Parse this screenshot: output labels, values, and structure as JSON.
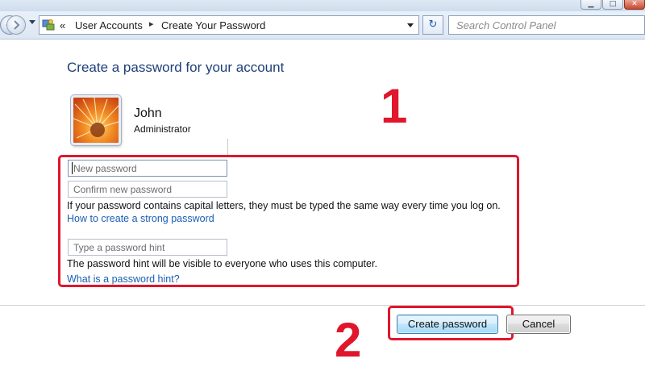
{
  "window": {
    "minimize_glyph": "▁",
    "maximize_glyph": "□",
    "close_glyph": "✕"
  },
  "navigation": {
    "breadcrumb_prefix": "«",
    "breadcrumbs": [
      "User Accounts",
      "Create Your Password"
    ],
    "separator": "▸",
    "refresh_glyph": "↻",
    "search_placeholder": "Search Control Panel"
  },
  "page": {
    "heading": "Create a password for your account",
    "user": {
      "name": "John",
      "role": "Administrator"
    },
    "fields": {
      "new_password_placeholder": "New password",
      "confirm_password_placeholder": "Confirm new password",
      "hint_placeholder": "Type a password hint"
    },
    "capital_letters_note": "If your password contains capital letters, they must be typed the same way every time you log on.",
    "strong_password_link": "How to create a strong password",
    "hint_visibility_note": "The password hint will be visible to everyone who uses this computer.",
    "hint_help_link": "What is a password hint?"
  },
  "annotations": {
    "step1": "1",
    "step2": "2",
    "color": "#e0162c"
  },
  "buttons": {
    "create": "Create password",
    "cancel": "Cancel"
  },
  "icons": {
    "back": "back-arrow-icon",
    "forward": "forward-arrow-icon",
    "control_panel": "control-panel-icon",
    "refresh": "refresh-icon",
    "search": "search-icon",
    "avatar": "flower-avatar"
  }
}
